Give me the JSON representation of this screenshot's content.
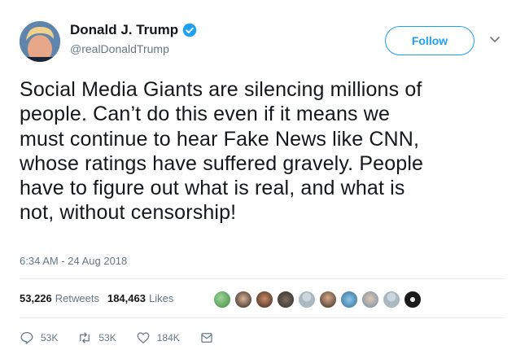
{
  "author": {
    "display_name": "Donald J. Trump",
    "handle": "@realDonaldTrump",
    "verified": true
  },
  "follow_button": {
    "label": "Follow"
  },
  "tweet": {
    "lines": [
      "Social Media Giants are silencing millions of",
      "people. Can’t do this even if it means we",
      "must continue to hear Fake News like CNN,",
      "whose ratings have suffered gravely. People",
      "have to figure out what is real, and what is",
      "not, without censorship!"
    ],
    "timestamp": "6:34 AM - 24 Aug 2018"
  },
  "stats": {
    "retweets_count": "53,226",
    "retweets_label": "Retweets",
    "likes_count": "184,463",
    "likes_label": "Likes"
  },
  "actions": {
    "reply_count": "53K",
    "retweet_count": "53K",
    "like_count": "184K"
  },
  "colors": {
    "accent": "#1da1f2",
    "text": "#14171a",
    "muted": "#657786",
    "divider": "#e6ecf0"
  },
  "icons": {
    "verified": "verified-badge-icon",
    "caret": "chevron-down-icon",
    "reply": "reply-icon",
    "retweet": "retweet-icon",
    "like": "heart-icon",
    "dm": "envelope-icon"
  }
}
